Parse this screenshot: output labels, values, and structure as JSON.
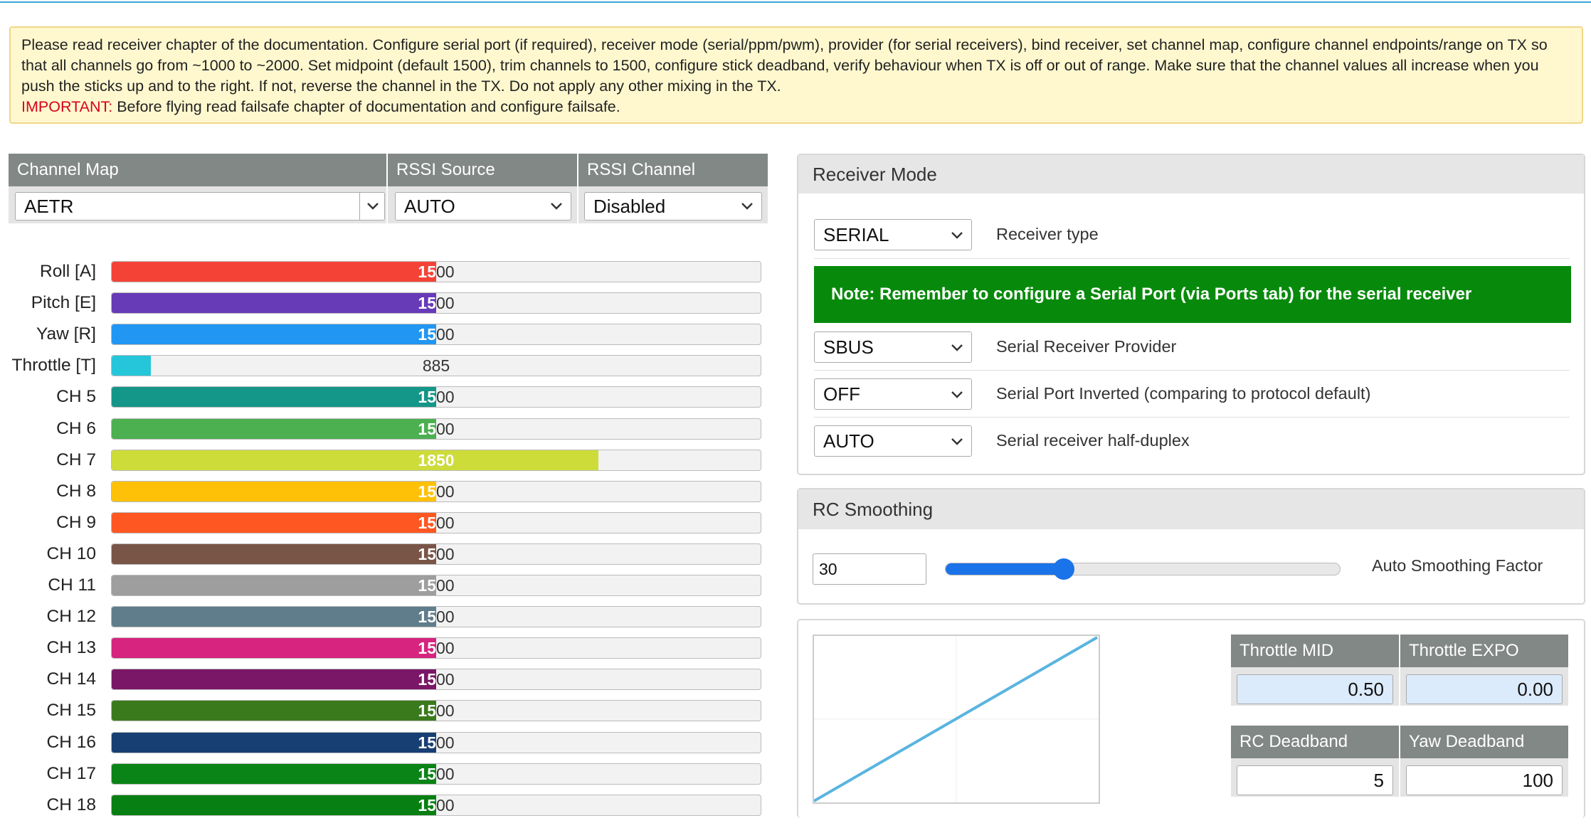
{
  "notice": {
    "text": "Please read receiver chapter of the documentation. Configure serial port (if required), receiver mode (serial/ppm/pwm), provider (for serial receivers), bind receiver, set channel map, configure channel endpoints/range on TX so that all channels go from ~1000 to ~2000. Set midpoint (default 1500), trim channels to 1500, configure stick deadband, verify behaviour when TX is off or out of range. Make sure that the channel values all increase when you push the sticks up and to the right. If not, reverse the channel in the TX. Do not apply any other mixing in the TX.",
    "important_label": "IMPORTANT:",
    "important_text": " Before flying read failsafe chapter of documentation and configure failsafe."
  },
  "channel_map": {
    "headers": {
      "channel_map": "Channel Map",
      "rssi_source": "RSSI Source",
      "rssi_channel": "RSSI Channel"
    },
    "channel_map_value": "AETR",
    "rssi_source_value": "AUTO",
    "rssi_channel_value": "Disabled"
  },
  "channels": [
    {
      "label": "Roll [A]",
      "value": "1500",
      "fraction": 0.5,
      "color": "#f44336"
    },
    {
      "label": "Pitch [E]",
      "value": "1500",
      "fraction": 0.5,
      "color": "#673ab7"
    },
    {
      "label": "Yaw [R]",
      "value": "1500",
      "fraction": 0.5,
      "color": "#2196f3"
    },
    {
      "label": "Throttle [T]",
      "value": "885",
      "fraction": 0.06,
      "color": "#26c6da"
    },
    {
      "label": "CH 5",
      "value": "1500",
      "fraction": 0.5,
      "color": "#149688"
    },
    {
      "label": "CH 6",
      "value": "1500",
      "fraction": 0.5,
      "color": "#4caf50"
    },
    {
      "label": "CH 7",
      "value": "1850",
      "fraction": 0.75,
      "color": "#cddc39"
    },
    {
      "label": "CH 8",
      "value": "1500",
      "fraction": 0.5,
      "color": "#ffc107"
    },
    {
      "label": "CH 9",
      "value": "1500",
      "fraction": 0.5,
      "color": "#ff5722"
    },
    {
      "label": "CH 10",
      "value": "1500",
      "fraction": 0.5,
      "color": "#795548"
    },
    {
      "label": "CH 11",
      "value": "1500",
      "fraction": 0.5,
      "color": "#9e9e9e"
    },
    {
      "label": "CH 12",
      "value": "1500",
      "fraction": 0.5,
      "color": "#607d8b"
    },
    {
      "label": "CH 13",
      "value": "1500",
      "fraction": 0.5,
      "color": "#d6247f"
    },
    {
      "label": "CH 14",
      "value": "1500",
      "fraction": 0.5,
      "color": "#7a1766"
    },
    {
      "label": "CH 15",
      "value": "1500",
      "fraction": 0.5,
      "color": "#3a7a1c"
    },
    {
      "label": "CH 16",
      "value": "1500",
      "fraction": 0.5,
      "color": "#173f73"
    },
    {
      "label": "CH 17",
      "value": "1500",
      "fraction": 0.5,
      "color": "#0a8416"
    },
    {
      "label": "CH 18",
      "value": "1500",
      "fraction": 0.5,
      "color": "#087f12"
    }
  ],
  "receiver_mode": {
    "title": "Receiver Mode",
    "receiver_type_value": "SERIAL",
    "receiver_type_label": "Receiver type",
    "note": "Note: Remember to configure a Serial Port (via Ports tab) for the serial receiver",
    "provider_value": "SBUS",
    "provider_label": "Serial Receiver Provider",
    "inverted_value": "OFF",
    "inverted_label": "Serial Port Inverted (comparing to protocol default)",
    "half_duplex_value": "AUTO",
    "half_duplex_label": "Serial receiver half-duplex"
  },
  "rc_smoothing": {
    "title": "RC Smoothing",
    "factor_value": "30",
    "factor_label": "Auto Smoothing Factor",
    "slider_fraction": 0.3
  },
  "throttle": {
    "mid_label": "Throttle MID",
    "expo_label": "Throttle EXPO",
    "mid_value": "0.50",
    "expo_value": "0.00",
    "rc_deadband_label": "RC Deadband",
    "yaw_deadband_label": "Yaw Deadband",
    "rc_deadband_value": "5",
    "yaw_deadband_value": "100"
  },
  "colors": {
    "accent": "#1a73e8",
    "note_green": "#078a0b",
    "header_gray": "#828885",
    "notice_bg": "#fff8cf",
    "highlight_input": "#dcebfb",
    "curve_line": "#5ab4e0"
  }
}
